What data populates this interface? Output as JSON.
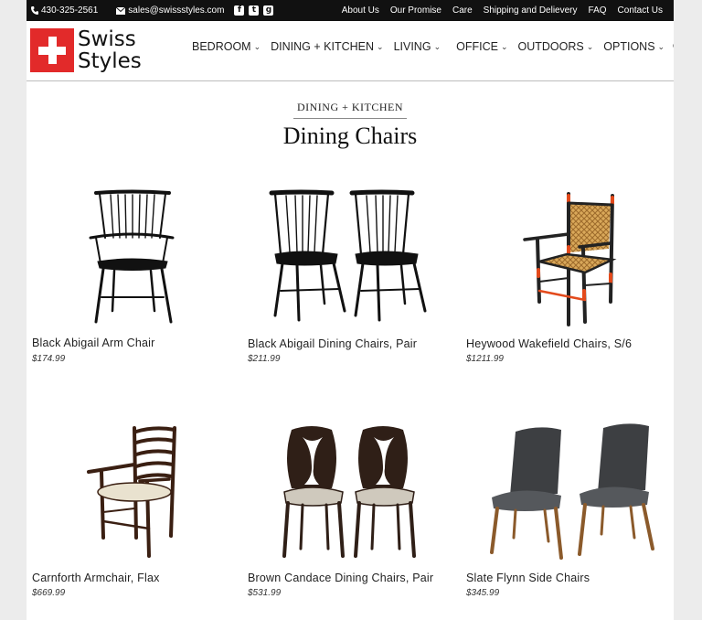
{
  "topbar": {
    "phone": "430-325-2561",
    "email": "sales@swissstyles.com",
    "social": [
      "facebook-icon",
      "twitter-icon",
      "google-plus-icon"
    ],
    "links": [
      "About Us",
      "Our Promise",
      "Care",
      "Shipping and Delievery",
      "FAQ",
      "Contact Us"
    ]
  },
  "logo": {
    "line1": "Swiss",
    "line2": "Styles",
    "brand_color": "#e22a2a"
  },
  "nav": [
    "BEDROOM",
    "DINING + KITCHEN",
    "LIVING",
    "OFFICE",
    "OUTDOORS",
    "OPTIONS"
  ],
  "breadcrumb": "DINING + KITCHEN",
  "page_title": "Dining Chairs",
  "products": [
    {
      "name": "Black Abigail Arm Chair",
      "price": "$174.99"
    },
    {
      "name": "Black Abigail Dining Chairs, Pair",
      "price": "$211.99"
    },
    {
      "name": "Heywood Wakefield Chairs, S/6",
      "price": "$1211.99"
    },
    {
      "name": "Carnforth Armchair, Flax",
      "price": "$669.99"
    },
    {
      "name": "Brown Candace Dining Chairs, Pair",
      "price": "$531.99"
    },
    {
      "name": "Slate Flynn Side Chairs",
      "price": "$345.99"
    }
  ]
}
